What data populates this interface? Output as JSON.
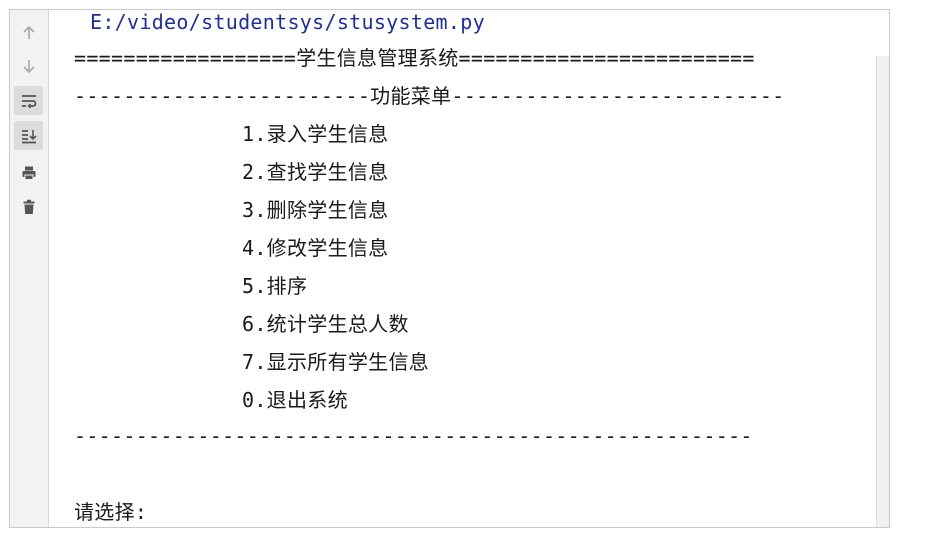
{
  "console": {
    "script_path": "E:/video/studentsys/stusystem.py",
    "header_rule": "==================学生信息管理系统========================",
    "menu_rule": "------------------------功能菜单---------------------------",
    "menu_items": [
      "1.录入学生信息",
      "2.查找学生信息",
      "3.删除学生信息",
      "4.修改学生信息",
      "5.排序",
      "6.统计学生总人数",
      "7.显示所有学生信息",
      "0.退出系统"
    ],
    "footer_rule": "-------------------------------------------------------",
    "prompt": "请选择:"
  },
  "toolbar": {
    "icons": [
      "arrow-up-icon",
      "arrow-down-icon",
      "soft-wrap-icon",
      "scroll-to-end-icon",
      "print-icon",
      "trash-icon"
    ]
  }
}
